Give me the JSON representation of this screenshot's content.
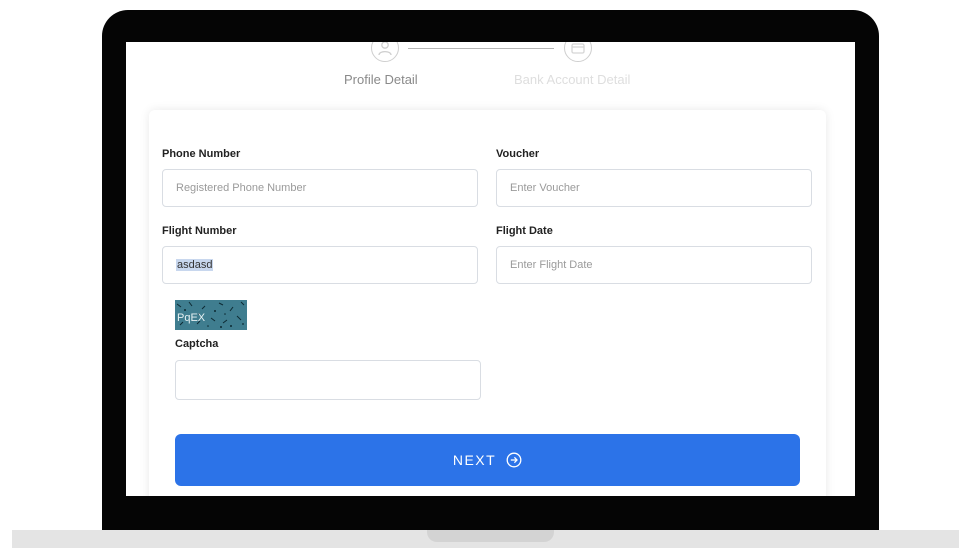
{
  "stepper": {
    "steps": [
      {
        "label": "Profile Detail",
        "state": "active"
      },
      {
        "label": "Bank Account Detail",
        "state": "inactive"
      }
    ]
  },
  "form": {
    "phone_label": "Phone Number",
    "phone_placeholder": "Registered Phone Number",
    "voucher_label": "Voucher",
    "voucher_placeholder": "Enter Voucher",
    "flight_number_label": "Flight Number",
    "flight_number_value": "asdasd",
    "flight_date_label": "Flight Date",
    "flight_date_placeholder": "Enter Flight Date",
    "captcha_image_text": "PqEX",
    "captcha_label": "Captcha",
    "captcha_value": "",
    "next_label": "NEXT"
  },
  "colors": {
    "primary": "#2c73e8",
    "frame": "#050505",
    "captcha_bg": "#3f7d8f"
  }
}
